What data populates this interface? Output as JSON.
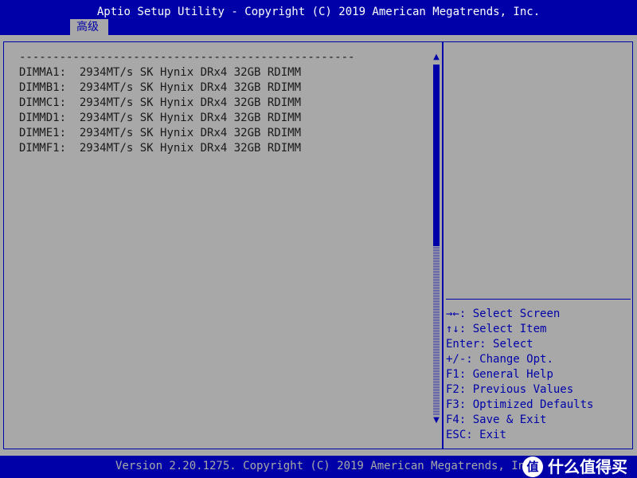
{
  "header": {
    "title": "Aptio Setup Utility - Copyright (C) 2019 American Megatrends, Inc."
  },
  "tabs": [
    {
      "label": "高级",
      "active": true
    }
  ],
  "main": {
    "separator": "--------------------------------------------------",
    "dimms": [
      {
        "slot": "DIMMA1:",
        "info": "2934MT/s SK Hynix DRx4 32GB RDIMM"
      },
      {
        "slot": "DIMMB1:",
        "info": "2934MT/s SK Hynix DRx4 32GB RDIMM"
      },
      {
        "slot": "DIMMC1:",
        "info": "2934MT/s SK Hynix DRx4 32GB RDIMM"
      },
      {
        "slot": "DIMMD1:",
        "info": "2934MT/s SK Hynix DRx4 32GB RDIMM"
      },
      {
        "slot": "DIMME1:",
        "info": "2934MT/s SK Hynix DRx4 32GB RDIMM"
      },
      {
        "slot": "DIMMF1:",
        "info": "2934MT/s SK Hynix DRx4 32GB RDIMM"
      }
    ]
  },
  "help": {
    "lines": [
      {
        "key": "→←:",
        "text": "Select Screen"
      },
      {
        "key": "↑↓:",
        "text": "Select Item"
      },
      {
        "key": "Enter:",
        "text": "Select"
      },
      {
        "key": "+/-:",
        "text": "Change Opt."
      },
      {
        "key": "F1:",
        "text": "General Help"
      },
      {
        "key": "F2:",
        "text": "Previous Values"
      },
      {
        "key": "F3:",
        "text": "Optimized Defaults"
      },
      {
        "key": "F4:",
        "text": "Save & Exit"
      },
      {
        "key": "ESC:",
        "text": "Exit"
      }
    ]
  },
  "footer": {
    "text": "Version 2.20.1275. Copyright (C) 2019 American Megatrends, Inc.",
    "watermark_logo": "值",
    "watermark_text": "什么值得买"
  },
  "scrollbar": {
    "up_arrow": "▲",
    "down_arrow": "▼"
  },
  "colors": {
    "bios_blue": "#0000a8",
    "bios_gray": "#a8a8a8",
    "text_dark": "#1a1a1a",
    "text_white": "#ffffff"
  }
}
